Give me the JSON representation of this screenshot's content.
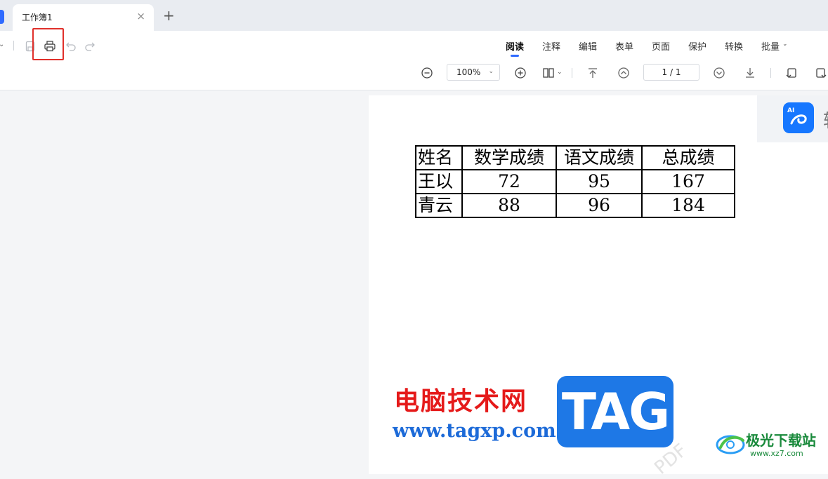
{
  "tabbar": {
    "tab_title": "工作簿1",
    "close_glyph": "×",
    "add_glyph": "+"
  },
  "menu": {
    "items": [
      {
        "label": "阅读",
        "active": true
      },
      {
        "label": "注释"
      },
      {
        "label": "编辑"
      },
      {
        "label": "表单"
      },
      {
        "label": "页面"
      },
      {
        "label": "保护"
      },
      {
        "label": "转换"
      },
      {
        "label": "批量"
      }
    ]
  },
  "zoom": {
    "value": "100%"
  },
  "pagination": {
    "display": "1 / 1"
  },
  "ai_panel": {
    "cut_text": "转"
  },
  "table": {
    "header": [
      "姓名",
      "数学成绩",
      "语文成绩",
      "总成绩"
    ],
    "rows": [
      [
        "王以",
        "72",
        "95",
        "167"
      ],
      [
        "青云",
        "88",
        "96",
        "184"
      ]
    ]
  },
  "watermark": {
    "site_name": "电脑技术网",
    "site_url": "www.tagxp.com",
    "tag_text": "TAG",
    "site2_name": "极光下载站",
    "site2_url": "www.xz7.com",
    "faint_text": "PDF"
  },
  "colors": {
    "accent": "#2f6bff",
    "highlight": "#e0302b"
  }
}
